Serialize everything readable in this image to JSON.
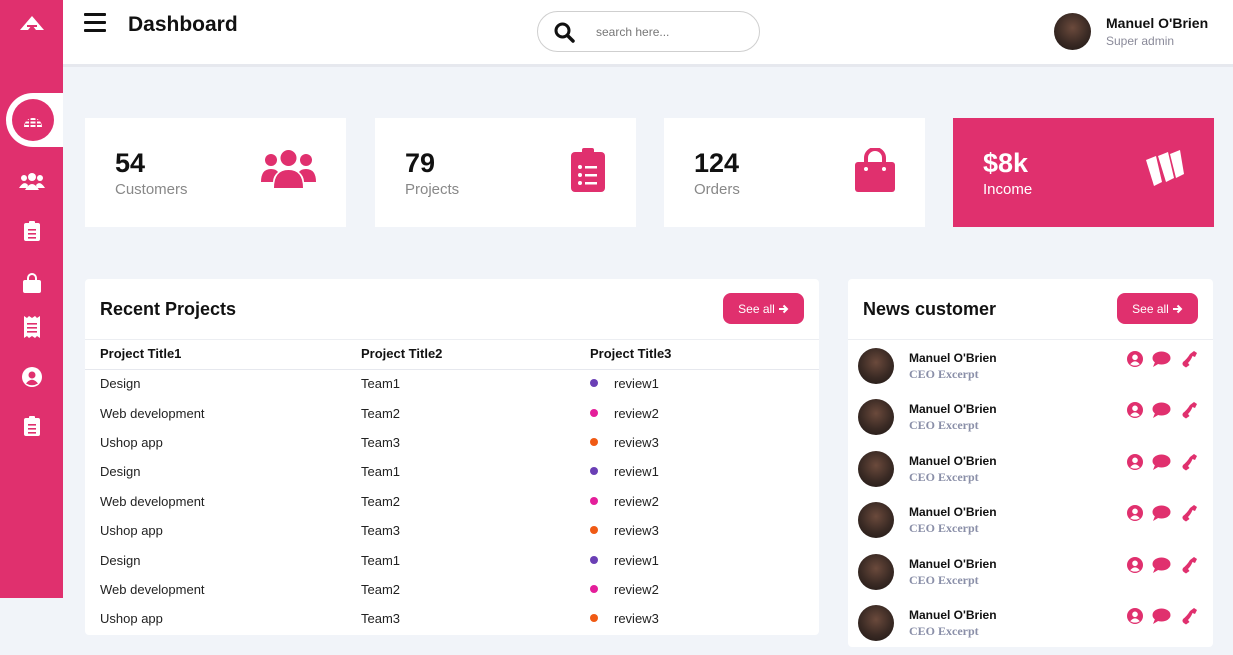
{
  "header": {
    "title": "Dashboard",
    "search_placeholder": "search here...",
    "user_name": "Manuel O'Brien",
    "user_role": "Super admin"
  },
  "sidebar": {
    "items": [
      "home-icon",
      "users-icon",
      "clipboard-icon",
      "shopping-bag-icon",
      "receipt-icon",
      "user-circle-icon",
      "clipboard-list-icon"
    ]
  },
  "cards": [
    {
      "number": "54",
      "label": "Customers",
      "icon": "users-icon"
    },
    {
      "number": "79",
      "label": "Projects",
      "icon": "clipboard-icon"
    },
    {
      "number": "124",
      "label": "Orders",
      "icon": "shopping-bag-icon"
    },
    {
      "number": "$8k",
      "label": "Income",
      "icon": "wallet-icon"
    }
  ],
  "recent_projects": {
    "title": "Recent Projects",
    "see_all": "See all",
    "columns": [
      "Project Title1",
      "Project Title2",
      "Project Title3"
    ],
    "rows": [
      [
        "Design",
        "Team1",
        "review1"
      ],
      [
        "Web development",
        "Team2",
        "review2"
      ],
      [
        "Ushop app",
        "Team3",
        "review3"
      ],
      [
        "Design",
        "Team1",
        "review1"
      ],
      [
        "Web development",
        "Team2",
        "review2"
      ],
      [
        "Ushop app",
        "Team3",
        "review3"
      ],
      [
        "Design",
        "Team1",
        "review1"
      ],
      [
        "Web development",
        "Team2",
        "review2"
      ],
      [
        "Ushop app",
        "Team3",
        "review3"
      ]
    ]
  },
  "news_customer": {
    "title": "News customer",
    "see_all": "See all",
    "items": [
      {
        "name": "Manuel O'Brien",
        "title": "CEO Excerpt"
      },
      {
        "name": "Manuel O'Brien",
        "title": "CEO Excerpt"
      },
      {
        "name": "Manuel O'Brien",
        "title": "CEO Excerpt"
      },
      {
        "name": "Manuel O'Brien",
        "title": "CEO Excerpt"
      },
      {
        "name": "Manuel O'Brien",
        "title": "CEO Excerpt"
      },
      {
        "name": "Manuel O'Brien",
        "title": "CEO Excerpt"
      }
    ]
  },
  "colors": {
    "accent": "#e0306e",
    "review1": "#6a3fb5",
    "review2": "#e41e9a",
    "review3": "#f05a14"
  }
}
